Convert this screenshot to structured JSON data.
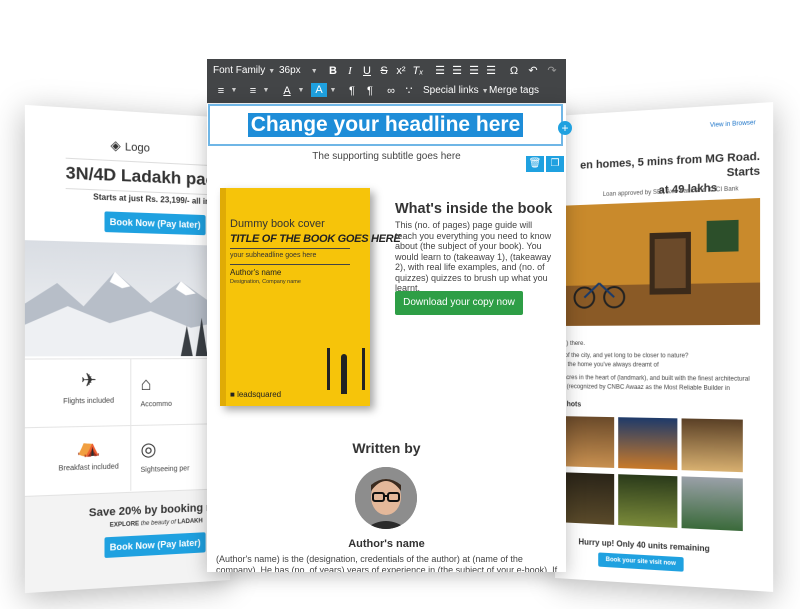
{
  "left_card": {
    "logo_text": "Logo",
    "title": "3N/4D Ladakh pack",
    "price_text": "Starts at just Rs. 23,199/- all inclu",
    "cta": "Book Now (Pay later)",
    "features": [
      {
        "icon": "plane-icon",
        "label": "Flights included"
      },
      {
        "icon": "hotel-icon",
        "label": "Accommo"
      },
      {
        "icon": "cloche-icon",
        "label": "Breakfast included"
      },
      {
        "icon": "camera-icon",
        "label": "Sightseeing per"
      }
    ],
    "promo_title": "Save 20% by booking no",
    "promo_sub_bold": "EXPLORE",
    "promo_sub_italic": "the beauty of",
    "promo_sub_end": "LADAKH",
    "promo_cta": "Book Now (Pay later)"
  },
  "right_card": {
    "view_in_browser": "View in Browser",
    "title_line1": "en homes, 5 mins from MG Road. Starts",
    "title_line2": "at 49 lakhs",
    "loan_text": "Loan approved by SBI, Axis Bank and ICICI Bank",
    "greeting": "me ,) there.",
    "para1": "pet of the city, and yet long to be closer to nature?",
    "para2": "e) is the home you've always dreamt of",
    "para3": "40 acres in the heart of (landmark), and built with the finest architectural",
    "para4": "me) (recognized by CNBC Awaaz as the Most Reliable Builder in",
    "snapshots": "hots",
    "hurry": "Hurry up! Only 40 units remaining",
    "cta": "Book your site visit now"
  },
  "toolbar": {
    "font_family": "Font Family",
    "font_size": "36px",
    "special_links": "Special links",
    "merge_tags": "Merge tags"
  },
  "editor": {
    "headline": "Change your headline here",
    "subtitle": "The supporting subtitle goes here",
    "book": {
      "line1": "Dummy book cover",
      "line2": "TITLE OF THE BOOK GOES HERE",
      "line3": "your subheadline goes here",
      "line4": "Author's name",
      "line5": "Designation, Company name",
      "brand": "leadsquared"
    },
    "inside_title": "What's inside the book",
    "inside_body": "This (no. of pages) page guide will teach you everything you need to know about (the subject of your book). You would learn to (takeaway 1), (takeaway 2), with real life examples, and (no. of quizzes) quizzes to brush up what you learnt.",
    "download_label": "Download your copy now",
    "written_by": "Written by",
    "author_name": "Author's name",
    "author_bio": "(Author's name) is the (designation, credentials of the author) at (name of the company). He has (no. of years) years of experience in (the subject of your e-book). If you have any"
  },
  "colors": {
    "toolbar_bg": "#434547",
    "accent_blue": "#1fa1e0",
    "headline_highlight": "#1e8dd8",
    "book_yellow": "#f6c40a",
    "download_green": "#2e9e46"
  }
}
